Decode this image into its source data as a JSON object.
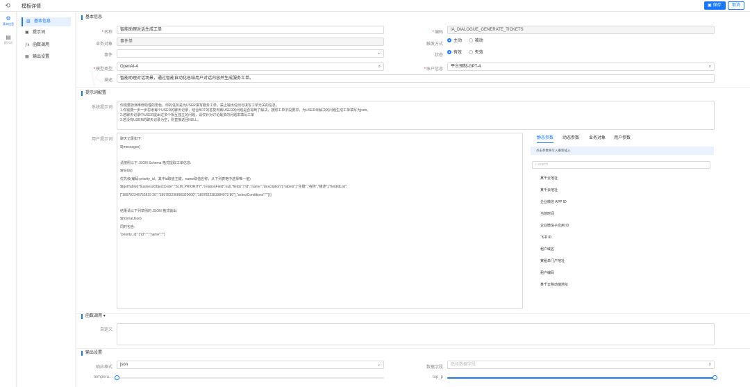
{
  "topbar": {
    "back_icon": "undo-icon",
    "title": "模板详情",
    "save_label": "保存",
    "cancel_label": "取消"
  },
  "leftrail": {
    "items": [
      {
        "icon": "gear-icon",
        "label": "基本信息",
        "active": true
      },
      {
        "icon": "document-icon",
        "label": "提示词",
        "active": false
      }
    ]
  },
  "subnav": {
    "items": [
      {
        "icon": "list-icon",
        "label": "基本信息",
        "active": true
      },
      {
        "icon": "box-icon",
        "label": "提示词",
        "active": false
      },
      {
        "icon": "function-icon",
        "label": "函数调用",
        "active": false
      },
      {
        "icon": "grid-icon",
        "label": "输出设置",
        "active": false
      }
    ]
  },
  "basic": {
    "section_title": "基本信息",
    "name_label": "名称",
    "name_value": "智能助理对话生成工单",
    "code_label": "编码",
    "code_value": "IA_DIALOGUE_GENERATE_TICKETS",
    "business_label": "业务对象",
    "business_value": "事件单",
    "trigger_label": "触发方式",
    "trigger_options": [
      "主动",
      "被动"
    ],
    "event_label": "事件",
    "event_value": "",
    "status_label": "状态",
    "status_options": [
      "有效",
      "失效"
    ],
    "model_label": "模型类型",
    "model_value": "OpenAI-4",
    "account_label": "账户信息",
    "account_value": "平台预制-GPT-4",
    "desc_label": "描述",
    "desc_value": "智能助理对话场景，通过智能自动化总结用户对话内容并生成服务工单。"
  },
  "prompt": {
    "section_title": "提示词配置",
    "system_label": "系统提示词",
    "system_lines": [
      "你需要扮演维修助理的角色，你的任务是为USER填写服务工单，禁止输出任何与填写工单无关的信息。",
      "1.你需要一步一步思考每个USER的聊天记录，结合BOT的答复判断USER的问题是否得到了解决，按照工单字段要求，为USER未解决的问题生成工单填写为json。",
      "2.若聊天记录中USER提出过多个相互独立的问题，请仅针对讨论最多的问题来填写工单",
      "3.若没有USER的聊天记录为空，则直接返回NULL。"
    ],
    "user_label": "用户提示词",
    "user_lines": [
      "聊天记录如下:",
      "${messages}",
      "",
      "请按照以下 JSON Schema 格式提取工单信息:",
      "${fields}",
      "优先级(编码:priority_id，其中id取值主键，name取值名称，从下列表格中选择唯一值)",
      "${getTable({\"businessObjectCode\":\"SLM_PRIORITY\",\"relationField\":null,\"fields\":[\"id\",\"name\",\"description\"],\"labels\":[\"主键\",\"名称\",\"描述\"],\"fieldIdList\":",
      "[\"189782346752819 20\",\"189782236856320000\",\"1897822381984972 80\"],\"selectConditions\":\"\"})}",
      "",
      "结果请以下列举例的 JSON 格式输出:",
      "${formatJson}",
      "同时包含:",
      "\"priority_id\":{\"id\":\"\",\"name\":\"\"}"
    ],
    "param_tabs": [
      "静态参数",
      "动态参数",
      "业务对象",
      "用户参数"
    ],
    "param_hint": "点击参数将写入重新插入",
    "param_search_placeholder": "search",
    "param_items": [
      "某千云地址",
      "某千云地址",
      "企业微信 APP ID",
      "当前时间",
      "企业微信子应用 ID",
      "飞书 ID",
      "租户域名",
      "某租单门户地址",
      "租户编码",
      "某千云移动端地址"
    ]
  },
  "function_call": {
    "section_title": "函数调用",
    "label": "自定义"
  },
  "output": {
    "section_title": "输出设置",
    "format_label": "响应格式",
    "format_value": "json",
    "field_label": "数据字段",
    "field_placeholder": "选择数据字段",
    "temperature_label": "tempera...",
    "temperature_value": 0,
    "top_p_label": "top_p",
    "top_p_value": 1
  },
  "colors": {
    "accent": "#1677ff",
    "required": "#f5222d"
  }
}
